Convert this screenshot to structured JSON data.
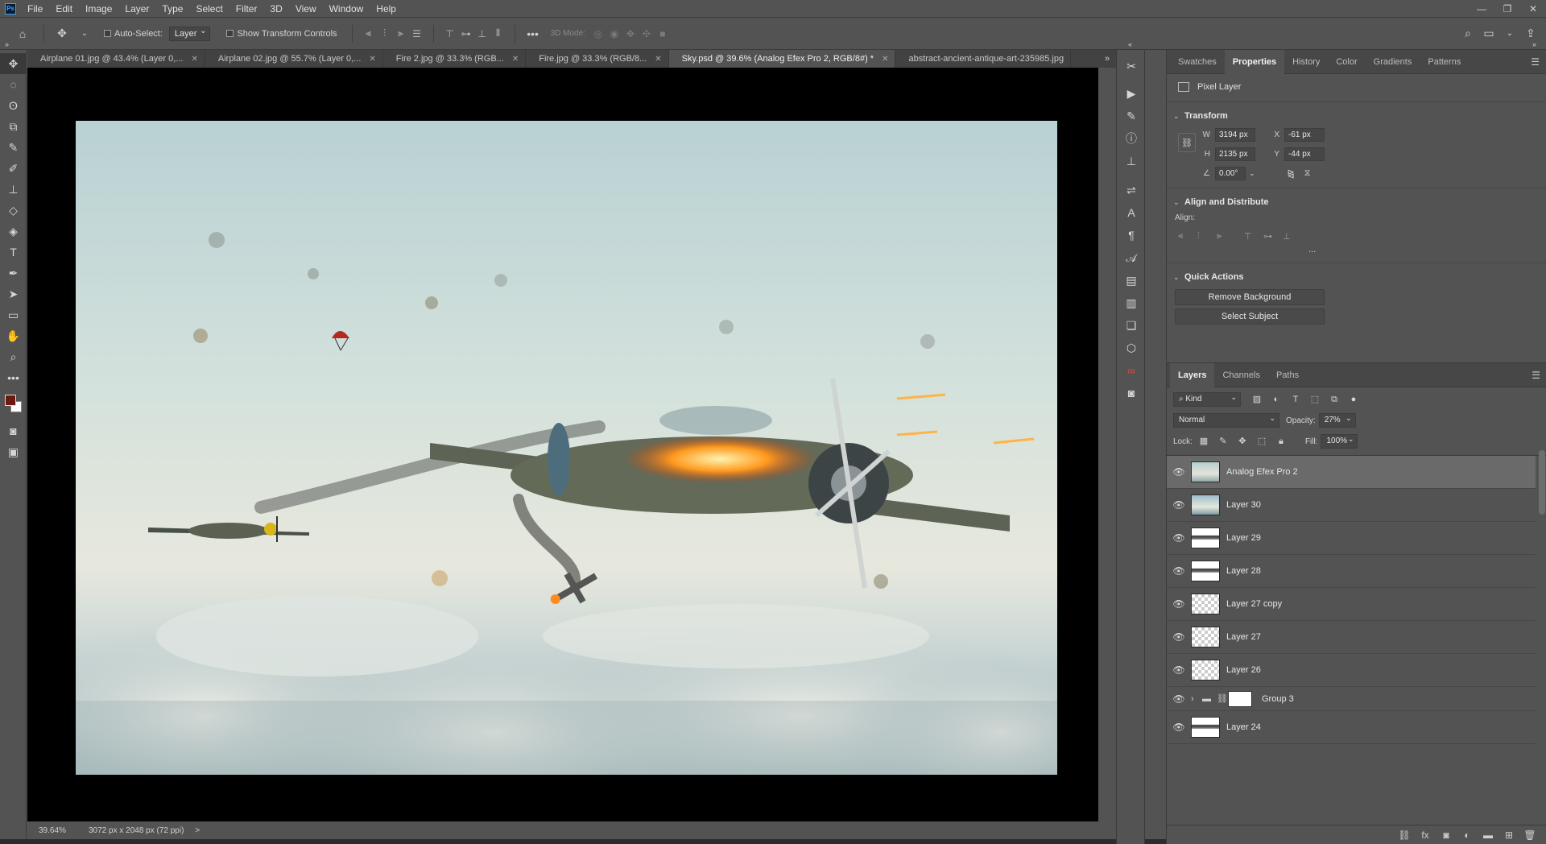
{
  "app": {
    "logo": "Ps"
  },
  "menu": [
    "File",
    "Edit",
    "Image",
    "Layer",
    "Type",
    "Select",
    "Filter",
    "3D",
    "View",
    "Window",
    "Help"
  ],
  "options": {
    "auto_select_label": "Auto-Select:",
    "auto_select_value": "Layer",
    "show_transform_label": "Show Transform Controls",
    "mode_3d_label": "3D Mode:"
  },
  "tabs": [
    {
      "label": "Airplane 01.jpg @ 43.4% (Layer 0,...",
      "active": false
    },
    {
      "label": "Airplane 02.jpg @ 55.7% (Layer 0,...",
      "active": false
    },
    {
      "label": "Fire 2.jpg @ 33.3% (RGB...",
      "active": false
    },
    {
      "label": "Fire.jpg @ 33.3% (RGB/8...",
      "active": false
    },
    {
      "label": "Sky.psd @ 39.6% (Analog Efex Pro 2, RGB/8#) *",
      "active": true
    },
    {
      "label": "abstract-ancient-antique-art-235985.jpg",
      "active": false
    }
  ],
  "status": {
    "zoom": "39.64%",
    "doc_info": "3072 px x 2048 px (72 ppi)",
    "arrow": ">"
  },
  "colors": {
    "foreground": "#6b1a0f",
    "background": "#ffffff",
    "accent": "#31a8ff"
  },
  "properties": {
    "tabs": [
      "Swatches",
      "Properties",
      "History",
      "Color",
      "Gradients",
      "Patterns"
    ],
    "active_tab": "Properties",
    "layer_kind": "Pixel Layer",
    "transform_title": "Transform",
    "w_label": "W",
    "w_value": "3194 px",
    "h_label": "H",
    "h_value": "2135 px",
    "x_label": "X",
    "x_value": "-61 px",
    "y_label": "Y",
    "y_value": "-44 px",
    "angle_value": "0.00°",
    "align_title": "Align and Distribute",
    "align_label": "Align:",
    "quick_actions_title": "Quick Actions",
    "remove_bg_label": "Remove Background",
    "select_subject_label": "Select Subject",
    "more": "..."
  },
  "layers_panel": {
    "tabs": [
      "Layers",
      "Channels",
      "Paths"
    ],
    "active_tab": "Layers",
    "filter_kind": "Kind",
    "blend_mode": "Normal",
    "opacity_label": "Opacity:",
    "opacity_value": "27%",
    "lock_label": "Lock:",
    "fill_label": "Fill:",
    "fill_value": "100%",
    "layers": [
      {
        "name": "Analog Efex Pro 2",
        "thumb": "sky",
        "selected": true
      },
      {
        "name": "Layer 30",
        "thumb": "sky2",
        "selected": false
      },
      {
        "name": "Layer 29",
        "thumb": "strip",
        "selected": false
      },
      {
        "name": "Layer 28",
        "thumb": "strip",
        "selected": false
      },
      {
        "name": "Layer 27 copy",
        "thumb": "checker",
        "selected": false
      },
      {
        "name": "Layer 27",
        "thumb": "checker",
        "selected": false
      },
      {
        "name": "Layer 26",
        "thumb": "checker",
        "selected": false
      },
      {
        "name": "Group 3",
        "thumb": "group",
        "selected": false
      },
      {
        "name": "Layer 24",
        "thumb": "strip",
        "selected": false
      }
    ]
  }
}
